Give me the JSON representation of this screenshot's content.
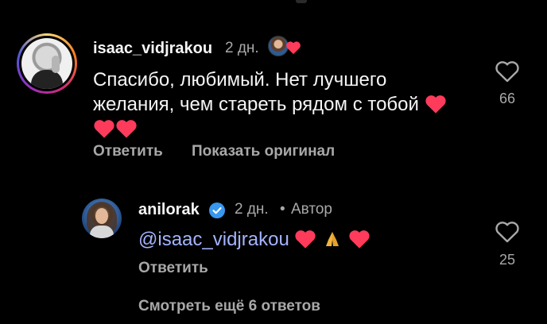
{
  "comment": {
    "username": "isaac_vidjrakou",
    "time": "2 дн.",
    "text_line1": "Спасибо, любимый. Нет лучшего",
    "text_line2": "желания, чем стареть рядом с тобой",
    "like_count": "66",
    "reply_label": "Ответить",
    "translate_label": "Показать оригинал"
  },
  "reply": {
    "username": "anilorak",
    "time": "2 дн.",
    "separator": "•",
    "author_badge": "Автор",
    "mention": "@isaac_vidjrakou",
    "like_count": "25",
    "reply_label": "Ответить"
  },
  "view_more": {
    "label": "Смотреть ещё 6 ответов"
  },
  "icons": {
    "like": "heart-outline-icon",
    "verified": "verified-badge-icon",
    "emoji_heart": "red-heart-emoji",
    "emoji_pray": "folded-hands-emoji"
  },
  "colors": {
    "background": "#000000",
    "primary_text": "#f5f5f5",
    "secondary_text": "#a8a8a8",
    "mention": "#a3b4ff",
    "heart": "#ff3b5c",
    "verified": "#3897f0"
  }
}
